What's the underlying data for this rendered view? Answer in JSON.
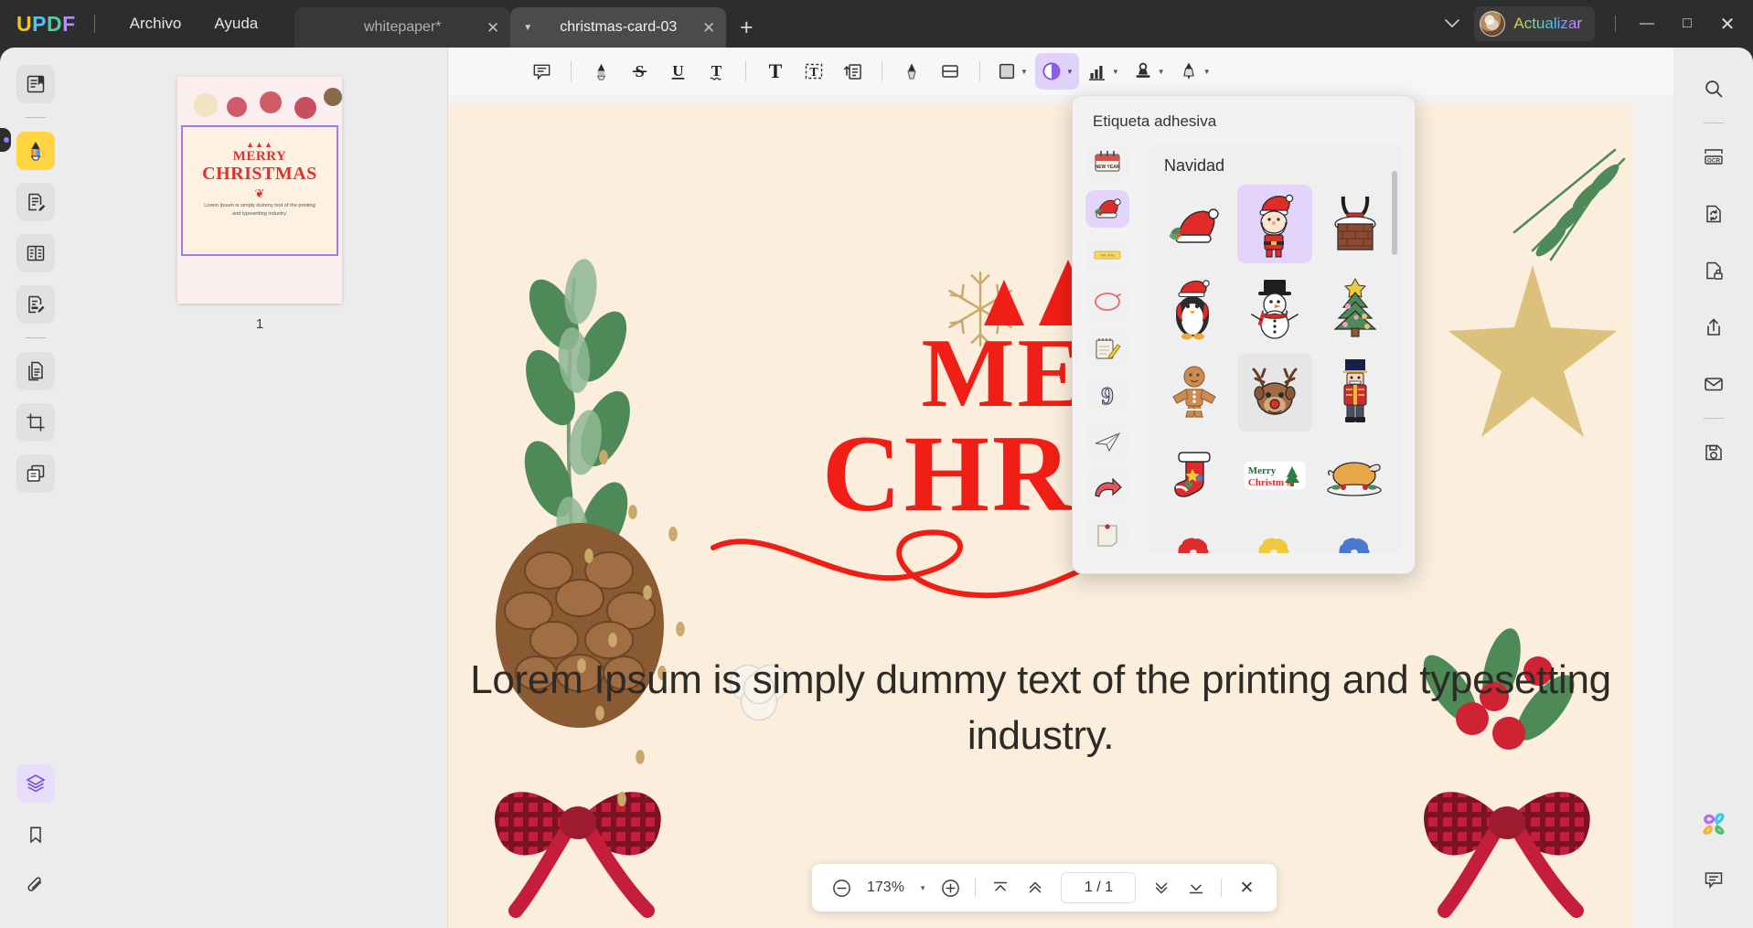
{
  "app": {
    "logo_letters": [
      "U",
      "P",
      "D",
      "F"
    ],
    "menus": [
      {
        "label": "Archivo",
        "name": "menu-archivo"
      },
      {
        "label": "Ayuda",
        "name": "menu-ayuda"
      }
    ],
    "tabs": [
      {
        "label": "whitepaper*",
        "active": false
      },
      {
        "label": "christmas-card-03",
        "active": true
      }
    ],
    "new_tab_label": "+",
    "window_controls": {
      "chevron": "⌄",
      "minimize": "—",
      "maximize": "□",
      "close": "✕"
    },
    "update_button": {
      "label": "Actualizar",
      "icon": "avatar-icon",
      "gradient": "#f0d23c → #d49bf0"
    }
  },
  "left_rail": {
    "items": [
      {
        "name": "sidebar-item-reader",
        "icon": "book-reader-icon",
        "state": "normal"
      },
      {
        "name": "sidebar-item-comment-highlight",
        "icon": "highlighter-marker-icon",
        "state": "active-yellow"
      },
      {
        "name": "sidebar-item-edit",
        "icon": "edit-document-icon",
        "state": "normal"
      },
      {
        "name": "sidebar-item-organize",
        "icon": "organize-pages-icon",
        "state": "normal"
      },
      {
        "name": "sidebar-item-sign",
        "icon": "sign-document-icon",
        "state": "normal"
      },
      {
        "name": "sidebar-item-pages",
        "icon": "copy-pages-icon",
        "state": "normal"
      },
      {
        "name": "sidebar-item-crop",
        "icon": "crop-icon",
        "state": "normal"
      },
      {
        "name": "sidebar-item-batch",
        "icon": "batch-layers-icon",
        "state": "normal"
      }
    ],
    "bottom_items": [
      {
        "name": "sidebar-item-layers",
        "icon": "layers-icon",
        "state": "active-purple"
      },
      {
        "name": "sidebar-item-bookmark",
        "icon": "bookmark-icon",
        "state": "normal"
      },
      {
        "name": "sidebar-item-attachment",
        "icon": "paperclip-icon",
        "state": "normal"
      }
    ]
  },
  "thumbnails": {
    "pages": [
      {
        "number": "1",
        "trees": "▲▲▲",
        "merry": "MERRY",
        "christmas": "CHRISTMAS",
        "swirl": "❦",
        "body": "Lorem Ipsum is simply dummy text of the printing and typesetting industry."
      }
    ]
  },
  "toolbar": {
    "tools": [
      {
        "name": "tool-note",
        "icon": "sticky-comment-icon",
        "label": "",
        "caret": false,
        "selected": false
      },
      {
        "name": "tool-highlight",
        "icon": "highlighter-icon",
        "label": "",
        "caret": false,
        "selected": false
      },
      {
        "name": "tool-strikethrough",
        "icon": "strikethrough-S-icon",
        "label": "S",
        "caret": false,
        "selected": false
      },
      {
        "name": "tool-underline",
        "icon": "underline-U-icon",
        "label": "U",
        "caret": false,
        "selected": false
      },
      {
        "name": "tool-squiggly",
        "icon": "squiggly-T-icon",
        "label": "T",
        "caret": false,
        "selected": false
      },
      {
        "name": "tool-text-box",
        "icon": "text-T-icon",
        "label": "T",
        "caret": false,
        "selected": false
      },
      {
        "name": "tool-text-callout",
        "icon": "text-box-dashed-icon",
        "label": "T",
        "caret": false,
        "selected": false
      },
      {
        "name": "tool-text-callout-arrow",
        "icon": "callout-arrow-icon",
        "label": "",
        "caret": false,
        "selected": false
      },
      {
        "name": "tool-pencil",
        "icon": "pencil-icon",
        "label": "",
        "caret": false,
        "selected": false
      },
      {
        "name": "tool-eraser",
        "icon": "eraser-icon",
        "label": "",
        "caret": false,
        "selected": false
      },
      {
        "name": "tool-shapes",
        "icon": "square-shape-icon",
        "label": "",
        "caret": true,
        "selected": false
      },
      {
        "name": "tool-sticker",
        "icon": "sticker-icon",
        "label": "",
        "caret": true,
        "selected": true
      },
      {
        "name": "tool-measure",
        "icon": "bar-chart-measure-icon",
        "label": "",
        "caret": true,
        "selected": false
      },
      {
        "name": "tool-stamp",
        "icon": "stamp-icon",
        "label": "",
        "caret": true,
        "selected": false
      },
      {
        "name": "tool-signature",
        "icon": "fountain-pen-icon",
        "label": "",
        "caret": true,
        "selected": false
      }
    ]
  },
  "sticker_popup": {
    "title": "Etiqueta adhesiva",
    "category_title": "Navidad",
    "categories": [
      {
        "name": "sticker-category-new-year",
        "icon": "new-year-calendar-icon",
        "label": "NEW YEAR",
        "selected": false
      },
      {
        "name": "sticker-category-navidad",
        "icon": "santa-hat-icon",
        "label": "Navidad",
        "selected": true
      },
      {
        "name": "sticker-category-tag",
        "icon": "yellow-tag-icon",
        "label": "",
        "selected": false
      },
      {
        "name": "sticker-category-circle",
        "icon": "red-circle-icon",
        "label": "",
        "selected": false
      },
      {
        "name": "sticker-category-notepad",
        "icon": "notepad-pencil-icon",
        "label": "",
        "selected": false
      },
      {
        "name": "sticker-category-numbers",
        "icon": "number-nine-icon",
        "label": "9",
        "selected": false
      },
      {
        "name": "sticker-category-paper-plane",
        "icon": "paper-plane-icon",
        "label": "",
        "selected": false
      },
      {
        "name": "sticker-category-arrow",
        "icon": "red-arrow-icon",
        "label": "",
        "selected": false
      },
      {
        "name": "sticker-category-note",
        "icon": "pinned-note-icon",
        "label": "",
        "selected": false
      }
    ],
    "stickers": [
      {
        "name": "sticker-santa-hat",
        "icon": "santa-hat-sticker",
        "state": "normal"
      },
      {
        "name": "sticker-santa-claus",
        "icon": "santa-claus-sticker",
        "state": "selected"
      },
      {
        "name": "sticker-chimney",
        "icon": "santa-chimney-sticker",
        "state": "normal"
      },
      {
        "name": "sticker-penguin",
        "icon": "penguin-sticker",
        "state": "normal"
      },
      {
        "name": "sticker-snowman",
        "icon": "snowman-sticker",
        "state": "normal"
      },
      {
        "name": "sticker-christmas-tree",
        "icon": "christmas-tree-sticker",
        "state": "normal"
      },
      {
        "name": "sticker-gingerbread",
        "icon": "gingerbread-man-sticker",
        "state": "normal"
      },
      {
        "name": "sticker-reindeer",
        "icon": "reindeer-sticker",
        "state": "hover"
      },
      {
        "name": "sticker-nutcracker",
        "icon": "nutcracker-sticker",
        "state": "normal"
      },
      {
        "name": "sticker-stocking",
        "icon": "christmas-stocking-sticker",
        "state": "normal"
      },
      {
        "name": "sticker-merry-christmas-text",
        "icon": "merry-christmas-text-sticker",
        "state": "normal"
      },
      {
        "name": "sticker-roast-turkey",
        "icon": "roast-turkey-sticker",
        "state": "normal"
      },
      {
        "name": "sticker-candy-cane-red",
        "icon": "candy-cane-red-sticker",
        "state": "normal"
      },
      {
        "name": "sticker-candy-cane-yellow",
        "icon": "candy-cane-yellow-sticker",
        "state": "normal"
      },
      {
        "name": "sticker-candy-cane-blue",
        "icon": "candy-cane-blue-sticker",
        "state": "normal"
      }
    ],
    "merry_text_line1": "Merry",
    "merry_text_line2": "Christm s"
  },
  "document": {
    "trees": "",
    "merry": "MER",
    "christmas": "CHRIST",
    "body": "Lorem Ipsum is simply dummy text of the printing and typesetting industry.",
    "background_color": "#fbeedd",
    "heading_color": "#f01e14"
  },
  "right_rail": {
    "items": [
      {
        "name": "right-item-search",
        "icon": "search-icon"
      },
      {
        "name": "right-item-ocr",
        "icon": "ocr-icon",
        "label": "OCR"
      },
      {
        "name": "right-item-convert",
        "icon": "convert-file-icon"
      },
      {
        "name": "right-item-protect",
        "icon": "lock-document-icon"
      },
      {
        "name": "right-item-share",
        "icon": "share-upload-icon"
      },
      {
        "name": "right-item-email",
        "icon": "envelope-icon"
      },
      {
        "name": "right-item-save",
        "icon": "save-floppy-icon"
      }
    ],
    "bottom_items": [
      {
        "name": "right-item-ai-assistant",
        "icon": "ai-flower-icon"
      },
      {
        "name": "right-item-comments-panel",
        "icon": "comment-bubble-icon"
      }
    ]
  },
  "bottom_bar": {
    "zoom_out": "−",
    "zoom_value": "173%",
    "zoom_caret": "▾",
    "zoom_in": "+",
    "first_page": "first-page-icon",
    "prev_page": "prev-page-icon",
    "page_indicator": "1 / 1",
    "next_page": "next-page-icon",
    "last_page": "last-page-icon",
    "close": "✕"
  }
}
